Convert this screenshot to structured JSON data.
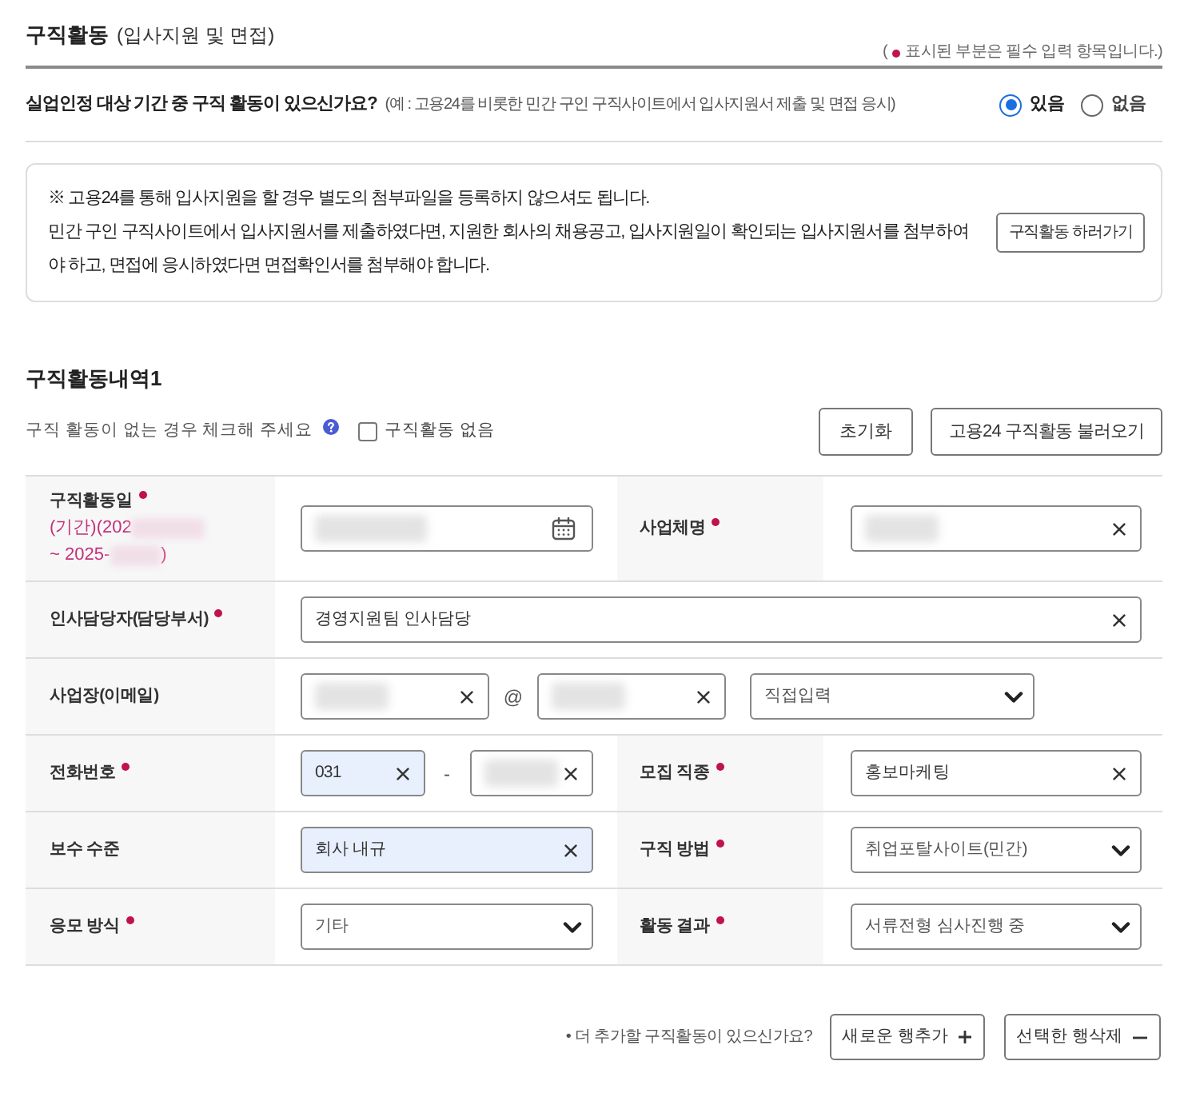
{
  "header": {
    "title": "구직활동",
    "subtitle": "(입사지원 및 면접)",
    "required_note": {
      "open": "(",
      "text": "표시된 부분은 필수 입력 항목입니다.)"
    }
  },
  "question": {
    "text": "실업인정 대상 기간 중 구직 활동이 있으신가요?",
    "hint": "(예 : 고용24를 비롯한 민간 구인 구직사이트에서 입사지원서 제출 및 면접 응시)",
    "options": [
      {
        "label": "있음",
        "selected": true
      },
      {
        "label": "없음",
        "selected": false
      }
    ]
  },
  "notice": {
    "lead": "※ 고용24를 통해 입사지원을 할 경우 별도의 첨부파일을 등록하지 않으셔도 됩니다.",
    "body": "민간 구인 구직사이트에서 입사지원서를 제출하였다면, 지원한 회사의 채용공고, 입사지원일이 확인되는 입사지원서를 첨부하여야 하고, 면접에 응시하였다면 면접확인서를 첨부해야 합니다.",
    "button": "구직활동 하러가기"
  },
  "section": {
    "title": "구직활동내역1",
    "hint": "구직 활동이 없는 경우 체크해 주세요",
    "no_activity": {
      "label": "구직활동 없음",
      "checked": false
    },
    "buttons": [
      "초기화",
      "고용24 구직활동 불러오기"
    ]
  },
  "table": {
    "rows": [
      {
        "cells": [
          {
            "kind": "label",
            "text": "구직활동일",
            "required": true,
            "period": [
              [
                {
                  "kind": "text",
                  "text": "(기간)(202"
                },
                {
                  "kind": "redacted"
                }
              ],
              [
                {
                  "kind": "text",
                  "text": "~ 2025-"
                },
                {
                  "kind": "redacted"
                },
                {
                  "kind": "text",
                  "text": ")"
                }
              ]
            ]
          },
          {
            "kind": "field",
            "inputs": [
              {
                "kind": "date",
                "redacted": true
              }
            ]
          },
          {
            "kind": "label",
            "text": "사업체명",
            "required": true
          },
          {
            "kind": "field",
            "inputs": [
              {
                "kind": "text",
                "redacted": true,
                "autofilled": false
              }
            ]
          }
        ]
      },
      {
        "cells": [
          {
            "kind": "label",
            "text": "인사담당자(담당부서)",
            "required": true
          },
          {
            "kind": "field",
            "colspan": 3,
            "inputs": [
              {
                "kind": "text",
                "value": "경영지원팀 인사담당",
                "autofilled": false
              }
            ]
          }
        ]
      },
      {
        "cells": [
          {
            "kind": "label",
            "text": "사업장(이메일)",
            "required": false
          },
          {
            "kind": "field",
            "colspan": 3,
            "inputs": [
              {
                "kind": "text",
                "redacted": true,
                "autofilled": false
              },
              {
                "kind": "separator",
                "text": "@"
              },
              {
                "kind": "text",
                "redacted": true,
                "autofilled": false
              },
              {
                "kind": "select",
                "value": "직접입력"
              }
            ]
          }
        ]
      },
      {
        "cells": [
          {
            "kind": "label",
            "text": "전화번호",
            "required": true
          },
          {
            "kind": "field",
            "inputs": [
              {
                "kind": "text",
                "value": "031",
                "autofilled": true
              },
              {
                "kind": "separator",
                "text": "-"
              },
              {
                "kind": "text",
                "redacted": true,
                "autofilled": false
              }
            ]
          },
          {
            "kind": "label",
            "text": "모집 직종",
            "required": true
          },
          {
            "kind": "field",
            "inputs": [
              {
                "kind": "text",
                "value": "홍보마케팅",
                "autofilled": false
              }
            ]
          }
        ]
      },
      {
        "cells": [
          {
            "kind": "label",
            "text": "보수 수준",
            "required": false
          },
          {
            "kind": "field",
            "inputs": [
              {
                "kind": "text",
                "value": "회사 내규",
                "autofilled": true
              }
            ]
          },
          {
            "kind": "label",
            "text": "구직 방법",
            "required": true
          },
          {
            "kind": "field",
            "inputs": [
              {
                "kind": "select",
                "value": "취업포탈사이트(민간)"
              }
            ]
          }
        ]
      },
      {
        "cells": [
          {
            "kind": "label",
            "text": "응모 방식",
            "required": true
          },
          {
            "kind": "field",
            "inputs": [
              {
                "kind": "select",
                "value": "기타"
              }
            ]
          },
          {
            "kind": "label",
            "text": "활동 결과",
            "required": true
          },
          {
            "kind": "field",
            "inputs": [
              {
                "kind": "select",
                "value": "서류전형 심사진행 중"
              }
            ]
          }
        ]
      }
    ]
  },
  "footer": {
    "prompt": "• 더 추가할 구직활동이 있으신가요?",
    "buttons": [
      {
        "label": "새로운 행추가",
        "kind": "add"
      },
      {
        "label": "선택한 행삭제",
        "kind": "remove"
      }
    ]
  }
}
